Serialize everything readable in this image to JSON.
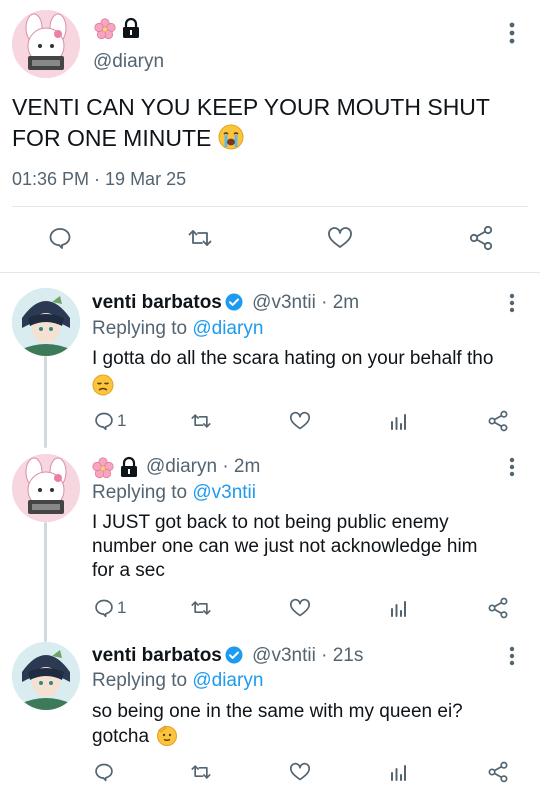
{
  "main_tweet": {
    "handle": "@diaryn",
    "text": "VENTI CAN YOU KEEP YOUR MOUTH SHUT FOR ONE MINUTE",
    "timestamp": "01:36 PM · 19 Mar 25",
    "badge_icons": [
      "cherry-blossom-icon",
      "lock-icon"
    ]
  },
  "replies": [
    {
      "name": "venti barbatos",
      "handle": "@v3ntii",
      "time": "· 2m",
      "replying_prefix": "Replying to",
      "replying_to": "@diaryn",
      "text": "I gotta do all the scara hating on your behalf tho",
      "reply_count": "1"
    },
    {
      "name": "",
      "handle": "@diaryn",
      "time": "· 2m",
      "replying_prefix": "Replying to",
      "replying_to": "@v3ntii",
      "text_lines": [
        "I JUST got back to not being public enemy",
        "number one can we just not acknowledge him",
        "for a sec"
      ],
      "reply_count": "1"
    },
    {
      "name": "venti barbatos",
      "handle": "@v3ntii",
      "time": "· 21s",
      "replying_prefix": "Replying to",
      "replying_to": "@diaryn",
      "text_lines": [
        "so being one in the same with my queen ei?",
        "gotcha"
      ],
      "reply_count": ""
    }
  ],
  "colors": {
    "text": "#0f1419",
    "muted": "#536471",
    "link": "#1d9bf0",
    "verified": "#1d9bf0",
    "divider": "#e1e8ed"
  }
}
